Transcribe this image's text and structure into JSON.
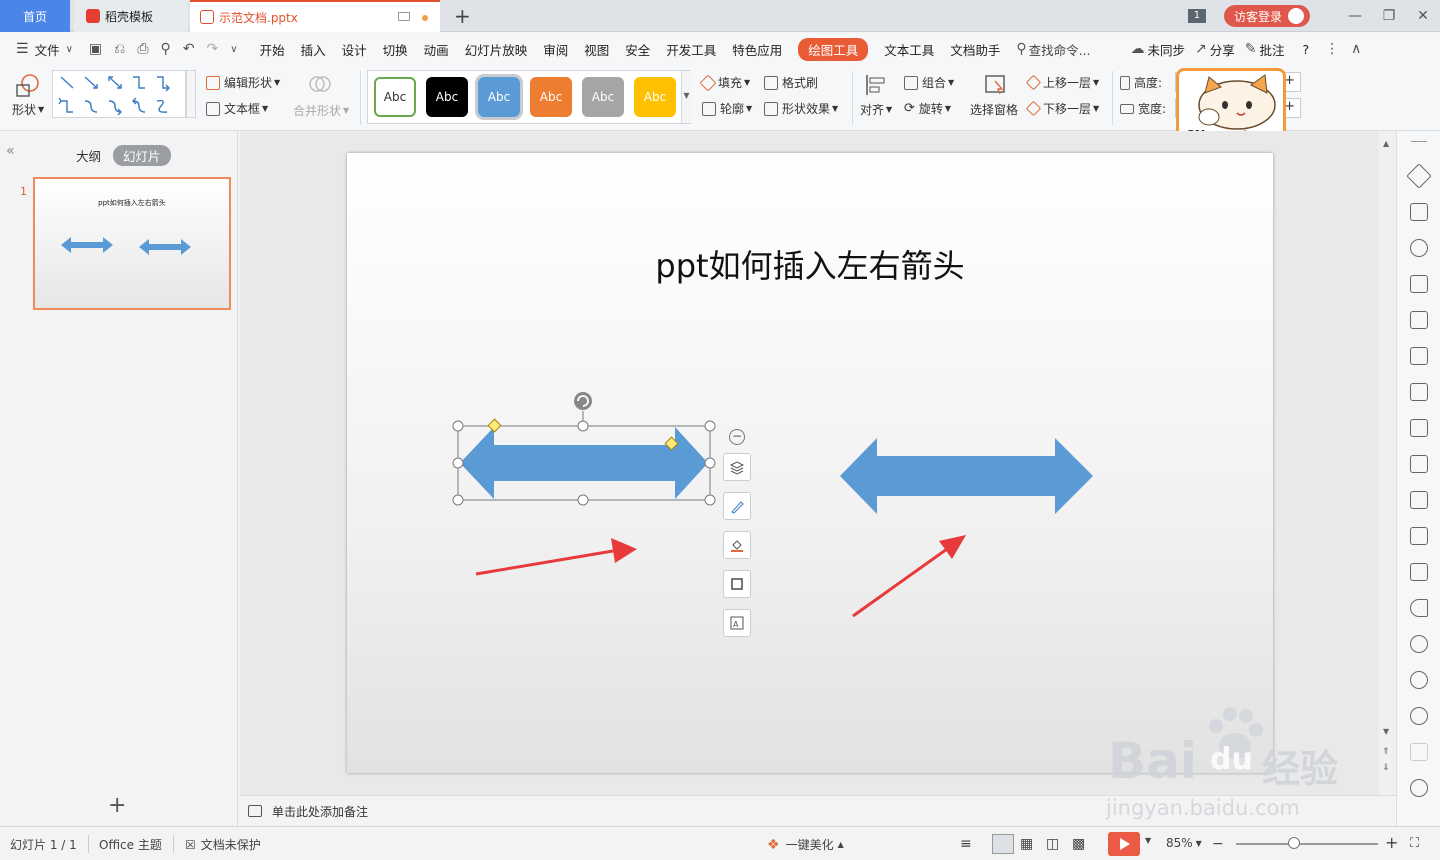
{
  "tabs": {
    "home": "首页",
    "daoke": "稻壳模板",
    "doc": "示范文档.pptx",
    "add": "+"
  },
  "titlebar": {
    "page_badge": "1",
    "login": "访客登录"
  },
  "menu": {
    "file": "文件",
    "items": [
      "开始",
      "插入",
      "设计",
      "切换",
      "动画",
      "幻灯片放映",
      "审阅",
      "视图",
      "安全",
      "开发工具",
      "特色应用",
      "绘图工具",
      "文本工具",
      "文档助手"
    ],
    "active": "绘图工具",
    "search": "查找命令...",
    "sync": "未同步",
    "share": "分享",
    "comment": "批注",
    "help": "?"
  },
  "ribbon": {
    "shape": "形状",
    "edit_shape": "编辑形状",
    "textbox": "文本框",
    "merge_shape": "合并形状",
    "style_label": "Abc",
    "fill": "填充",
    "format_painter": "格式刷",
    "outline": "轮廓",
    "shape_effect": "形状效果",
    "align": "对齐",
    "group": "组合",
    "rotate": "旋转",
    "select_pane": "选择窗格",
    "bring_forward": "上移一层",
    "send_backward": "下移一层",
    "height": "高度:",
    "width": "宽度:",
    "style_colors": [
      "#ffffff",
      "#000000",
      "#5b9bd5",
      "#ed7d31",
      "#a5a5a5",
      "#ffc000"
    ],
    "style_text_colors": [
      "#333333",
      "#ffffff",
      "#ffffff",
      "#ffffff",
      "#ffffff",
      "#ffffff"
    ]
  },
  "left_panel": {
    "outline_tab": "大纲",
    "slides_tab": "幻灯片",
    "slide_number": "1",
    "thumb_title": "ppt如何插入左右箭头"
  },
  "slide": {
    "title": "ppt如何插入左右箭头",
    "arrow_color": "#5b9bd5",
    "pointer_color": "#e83a3a"
  },
  "notes": {
    "placeholder": "单击此处添加备注"
  },
  "mascot": {
    "text": "CN"
  },
  "status": {
    "slide_info": "幻灯片 1 / 1",
    "theme": "Office 主题",
    "protect": "文档未保护",
    "beautify": "一键美化",
    "zoom": "85%"
  },
  "watermark": {
    "brand": "Bai",
    "brand2": "du",
    "site": "经验",
    "url": "jingyan.baidu.com"
  }
}
